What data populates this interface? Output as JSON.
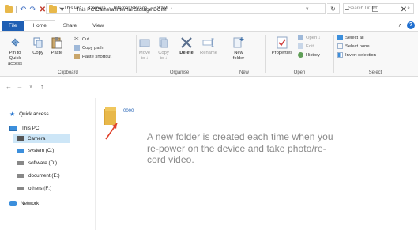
{
  "window": {
    "title": "This PC\\Camera\\Internal Storage\\DCIM",
    "minimize": "–",
    "maximize": "☐",
    "close": "✕"
  },
  "tabs": [
    {
      "label": "File"
    },
    {
      "label": "Home"
    },
    {
      "label": "Share"
    },
    {
      "label": "View"
    }
  ],
  "ribbon": {
    "clipboard": {
      "label": "Clipboard",
      "pin": "Pin to Quick\naccess",
      "copy": "Copy",
      "paste": "Paste",
      "cut": "Cut",
      "copy_path": "Copy path",
      "paste_shortcut": "Paste shortcut"
    },
    "organise": {
      "label": "Organise",
      "move_to": "Move\nto ↓",
      "copy_to": "Copy\nto ↓",
      "delete": "Delete",
      "rename": "Rename"
    },
    "new": {
      "label": "New",
      "new_folder": "New\nfolder"
    },
    "open": {
      "label": "Open",
      "properties": "Properties",
      "open_item": "Open ↓",
      "edit": "Edit",
      "history": "History"
    },
    "select": {
      "label": "Select",
      "select_all": "Select all",
      "select_none": "Select none",
      "invert": "Invert selection"
    }
  },
  "address": {
    "crumbs": [
      "This PC",
      "Camera",
      "Internal Storage",
      "DCIM"
    ],
    "search_placeholder": "Search DCIM"
  },
  "nav": {
    "quick_access": "Quick access",
    "this_pc": "This PC",
    "camera": "Camera",
    "system": "system (C:)",
    "software": "software (D:)",
    "document": "document (E:)",
    "others": "others (F:)",
    "network": "Network"
  },
  "content": {
    "folder_name": "0000",
    "caption_lines": [
      "A new folder is created each time when you",
      "re-power on the device and take photo/re-",
      "cord video."
    ]
  },
  "colors": {
    "file_tab": "#1f5fb4",
    "folder": "#e8b84a",
    "arrow": "#e0402a",
    "selection": "#cde6f7"
  }
}
